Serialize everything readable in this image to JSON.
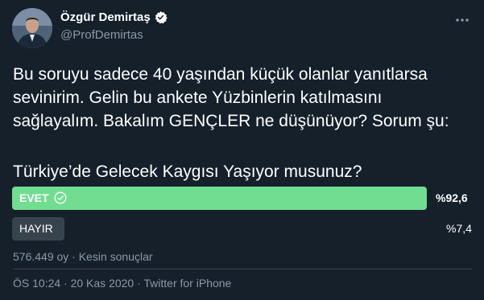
{
  "author": {
    "display_name": "Özgür Demirtaş",
    "handle": "@ProfDemirtas",
    "avatar_icon": "profile-photo",
    "verified_icon": "verified-badge-icon"
  },
  "tweet": {
    "lines": [
      "Bu soruyu sadece 40 yaşından küçük olanlar yanıtlarsa",
      "sevinirim. Gelin bu ankete Yüzbinlerin katılmasını",
      "sağlayalım. Bakalım GENÇLER ne düşünüyor? Sorum şu:"
    ],
    "question": "Türkiye’de Gelecek Kaygısı Yaşıyor musunuz?"
  },
  "poll": {
    "options": [
      {
        "label": "EVET",
        "percent_text": "%92,6",
        "share": 0.926,
        "winner": true,
        "color": "#71dd91"
      },
      {
        "label": "HAYIR",
        "percent_text": "%7,4",
        "share": 0.074,
        "winner": false,
        "color": "#38444d"
      }
    ],
    "meta": "576.449 oy · Kesin sonuçlar"
  },
  "footer": {
    "timestamp": "ÖS 10:24 · 20 Kas 2020 · Twitter for iPhone"
  },
  "colors": {
    "background": "#15202b",
    "secondary_text": "#8899a6",
    "accent_win": "#71dd91",
    "bar_lose": "#38444d"
  }
}
